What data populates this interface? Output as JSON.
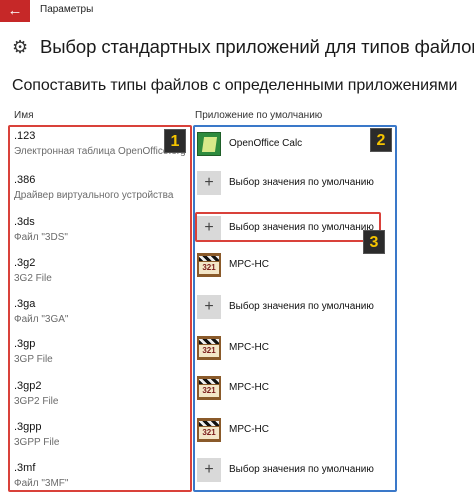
{
  "window": {
    "back_label": "←",
    "title": "Параметры"
  },
  "page": {
    "icon": "gear-icon",
    "title": "Выбор стандартных приложений для типов файлов",
    "section_title": "Сопоставить типы файлов с определенными приложениями"
  },
  "columns": {
    "name": "Имя",
    "app": "Приложение по умолчанию"
  },
  "file_types": [
    {
      "ext": ".123",
      "desc": "Электронная таблица OpenOffice.org"
    },
    {
      "ext": ".386",
      "desc": "Драйвер виртуального устройства"
    },
    {
      "ext": ".3ds",
      "desc": "Файл \"3DS\""
    },
    {
      "ext": ".3g2",
      "desc": "3G2 File"
    },
    {
      "ext": ".3ga",
      "desc": "Файл \"3GA\""
    },
    {
      "ext": ".3gp",
      "desc": "3GP File"
    },
    {
      "ext": ".3gp2",
      "desc": "3GP2 File"
    },
    {
      "ext": ".3gpp",
      "desc": "3GPP File"
    },
    {
      "ext": ".3mf",
      "desc": "Файл \"3MF\""
    }
  ],
  "apps": [
    {
      "icon": "openoffice-calc-icon",
      "label": "OpenOffice Calc"
    },
    {
      "icon": "plus-icon",
      "label": "Выбор значения по умолчанию"
    },
    {
      "icon": "plus-icon",
      "label": "Выбор значения по умолчанию"
    },
    {
      "icon": "mpc-hc-icon",
      "label": "MPC-HC",
      "icon_text": "321"
    },
    {
      "icon": "plus-icon",
      "label": "Выбор значения по умолчанию"
    },
    {
      "icon": "mpc-hc-icon",
      "label": "MPC-HC",
      "icon_text": "321"
    },
    {
      "icon": "mpc-hc-icon",
      "label": "MPC-HC",
      "icon_text": "321"
    },
    {
      "icon": "mpc-hc-icon",
      "label": "MPC-HC",
      "icon_text": "321"
    },
    {
      "icon": "plus-icon",
      "label": "Выбор значения по умолчанию"
    }
  ],
  "annotations": {
    "badge_1": "1",
    "badge_2": "2",
    "badge_3": "3",
    "colors": {
      "red": "#d9413a",
      "blue": "#3a78c9",
      "badge_text": "#f5c400"
    }
  },
  "plus_glyph": "+"
}
